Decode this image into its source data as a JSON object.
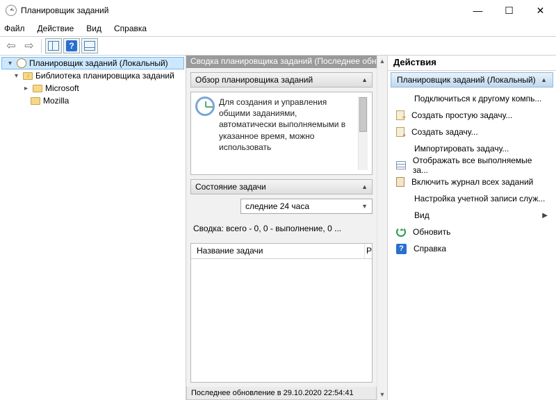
{
  "window": {
    "title": "Планировщик заданий"
  },
  "menu": {
    "file": "Файл",
    "action": "Действие",
    "view": "Вид",
    "help": "Справка"
  },
  "tree": {
    "root": "Планировщик заданий (Локальный)",
    "lib": "Библиотека планировщика заданий",
    "items": [
      "Microsoft",
      "Mozilla"
    ]
  },
  "center": {
    "header": "Сводка планировщика заданий (Последнее обновление",
    "overview_title": "Обзор планировщика заданий",
    "overview_text": "Для создания и управления общими заданиями, автоматически выполняемыми в указанное время, можно использовать",
    "state_title": "Состояние задачи",
    "combo": "следние 24 часа",
    "summary": "Сводка: всего - 0, 0 - выполнение, 0 ...",
    "col_name": "Название задачи",
    "col_r": "Р",
    "bottom": "Последнее обновление в 29.10.2020 22:54:41"
  },
  "actions": {
    "header": "Действия",
    "group": "Планировщик заданий (Локальный)",
    "items": [
      "Подключиться к другому компь...",
      "Создать простую задачу...",
      "Создать задачу...",
      "Импортировать задачу...",
      "Отображать все выполняемые за...",
      "Включить журнал всех заданий",
      "Настройка учетной записи служ...",
      "Вид",
      "Обновить",
      "Справка"
    ]
  }
}
